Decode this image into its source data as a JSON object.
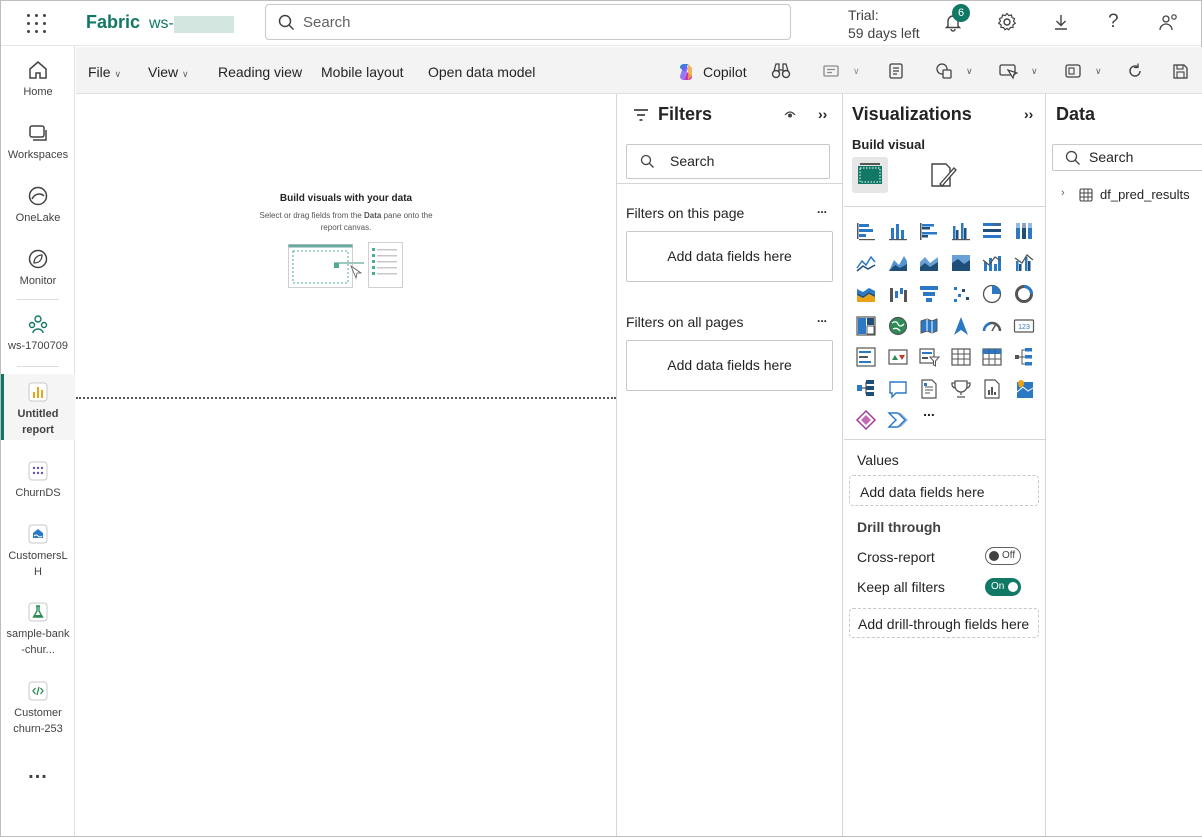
{
  "topbar": {
    "brand": "Fabric",
    "workspace": "ws-",
    "search_placeholder": "Search",
    "trial_line1": "Trial:",
    "trial_line2": "59 days left",
    "notification_count": "6"
  },
  "nav": {
    "home": "Home",
    "workspaces": "Workspaces",
    "onelake": "OneLake",
    "monitor": "Monitor",
    "ws_item": "ws-1700709",
    "untitled": "Untitled report",
    "churnds": "ChurnDS",
    "customerslh": "CustomersLH",
    "sample": "sample-bank-chur...",
    "customer_churn": "Customer churn-253",
    "more": "..."
  },
  "toolbar": {
    "file": "File",
    "view": "View",
    "reading_view": "Reading view",
    "mobile_layout": "Mobile layout",
    "open_data_model": "Open data model",
    "copilot": "Copilot"
  },
  "canvas": {
    "title": "Build visuals with your data",
    "sub1": "Select or drag fields from the",
    "sub_bold": "Data",
    "sub2": "pane onto the",
    "sub3": "report canvas."
  },
  "filters": {
    "title": "Filters",
    "search_placeholder": "Search",
    "on_page": "Filters on this page",
    "on_page_add": "Add data fields here",
    "all_pages": "Filters on all pages",
    "all_pages_add": "Add data fields here",
    "more": "..."
  },
  "viz": {
    "title": "Visualizations",
    "build_visual": "Build visual",
    "values": "Values",
    "values_add": "Add data fields here",
    "drill_through": "Drill through",
    "cross_report": "Cross-report",
    "cross_report_state": "Off",
    "keep_filters": "Keep all filters",
    "keep_filters_state": "On",
    "drill_add": "Add drill-through fields here",
    "more": "..."
  },
  "data": {
    "title": "Data",
    "search_placeholder": "Search",
    "table": "df_pred_results"
  },
  "colors": {
    "accent": "#117865",
    "icon_blue": "#2b78c5"
  }
}
